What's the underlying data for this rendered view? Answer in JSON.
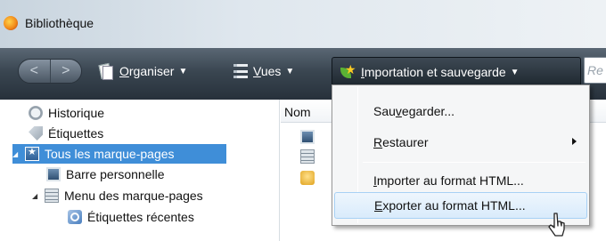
{
  "window": {
    "title": "Bibliothèque"
  },
  "toolbar": {
    "back_label": "<",
    "forward_label": ">",
    "organise": {
      "pre": "",
      "u": "O",
      "post": "rganiser"
    },
    "views": {
      "pre": "",
      "u": "V",
      "post": "ues"
    },
    "import_save": {
      "pre": "",
      "u": "I",
      "post": "mportation et sauvegarde"
    },
    "search_text": "Re"
  },
  "sidebar": {
    "items": [
      {
        "label": "Historique"
      },
      {
        "label": "Étiquettes"
      },
      {
        "label": "Tous les marque-pages",
        "selected": true
      },
      {
        "label": "Barre personnelle"
      },
      {
        "label": "Menu des marque-pages"
      },
      {
        "label": "Étiquettes récentes"
      }
    ]
  },
  "list": {
    "column_name": "Nom"
  },
  "menu": {
    "items": [
      {
        "pre": "Sau",
        "u": "v",
        "post": "egarder..."
      },
      {
        "pre": "",
        "u": "R",
        "post": "estaurer",
        "has_submenu": true
      },
      {
        "pre": "",
        "u": "I",
        "post": "mporter au format HTML..."
      },
      {
        "pre": "",
        "u": "E",
        "post": "xporter au format HTML...",
        "hovered": true
      }
    ]
  },
  "colors": {
    "selection": "#3f8ed8",
    "toolbar": "#2f3a44",
    "menu_hover": "#d9ebfb"
  },
  "icons": [
    "firefox-logo",
    "organise-icon",
    "views-icon",
    "import-star-icon",
    "history-icon",
    "tag-icon",
    "star-folder-icon",
    "bookmark-bar-icon",
    "bookmark-menu-icon",
    "search-tag-icon",
    "mouse-cursor-icon"
  ]
}
